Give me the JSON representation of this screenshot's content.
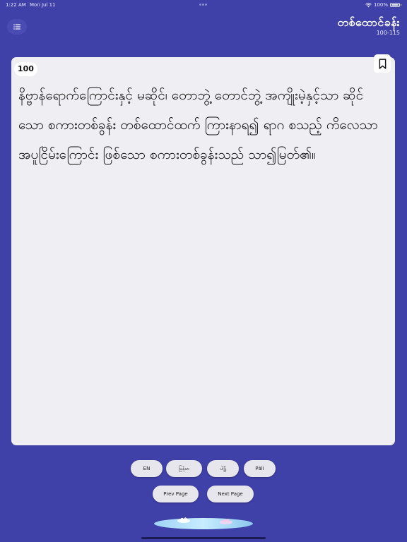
{
  "status_bar": {
    "time": "1:22 AM",
    "date": "Mon Jul 11",
    "battery_text": "100%"
  },
  "header": {
    "title": "တစ်ထောင်ခန်း",
    "range": "100-115"
  },
  "page": {
    "number": "100",
    "text": "နိဗ္ဗာန်ရောက်ကြောင်းနှင့် မဆိုင်၊ တောဘွဲ့ တောင်ဘွဲ့ အကျိုးမဲ့နှင့်သာ ဆိုင်သော စကားတစ်ခွန်း တစ်ထောင်ထက် ကြားနာရ၍ ရာဂ စသည့် ကိလေသာ အပူငြိမ်းကြောင်း ဖြစ်သော စကားတစ်ခွန်းသည် သာ၍မြတ်၏။"
  },
  "languages": {
    "en": "EN",
    "my": "မြန်မာ",
    "pali_my": "ပါဠိ",
    "pali": "Pāli"
  },
  "nav": {
    "prev": "Prev Page",
    "next": "Next Page"
  },
  "colors": {
    "background": "#3f40a8",
    "card": "#eeeef3",
    "pill": "#e6e6ec"
  },
  "icons": {
    "menu": "list-icon",
    "bookmark": "bookmark-icon",
    "wifi": "wifi-icon",
    "battery": "battery-icon",
    "decor": "lotus-icon"
  }
}
